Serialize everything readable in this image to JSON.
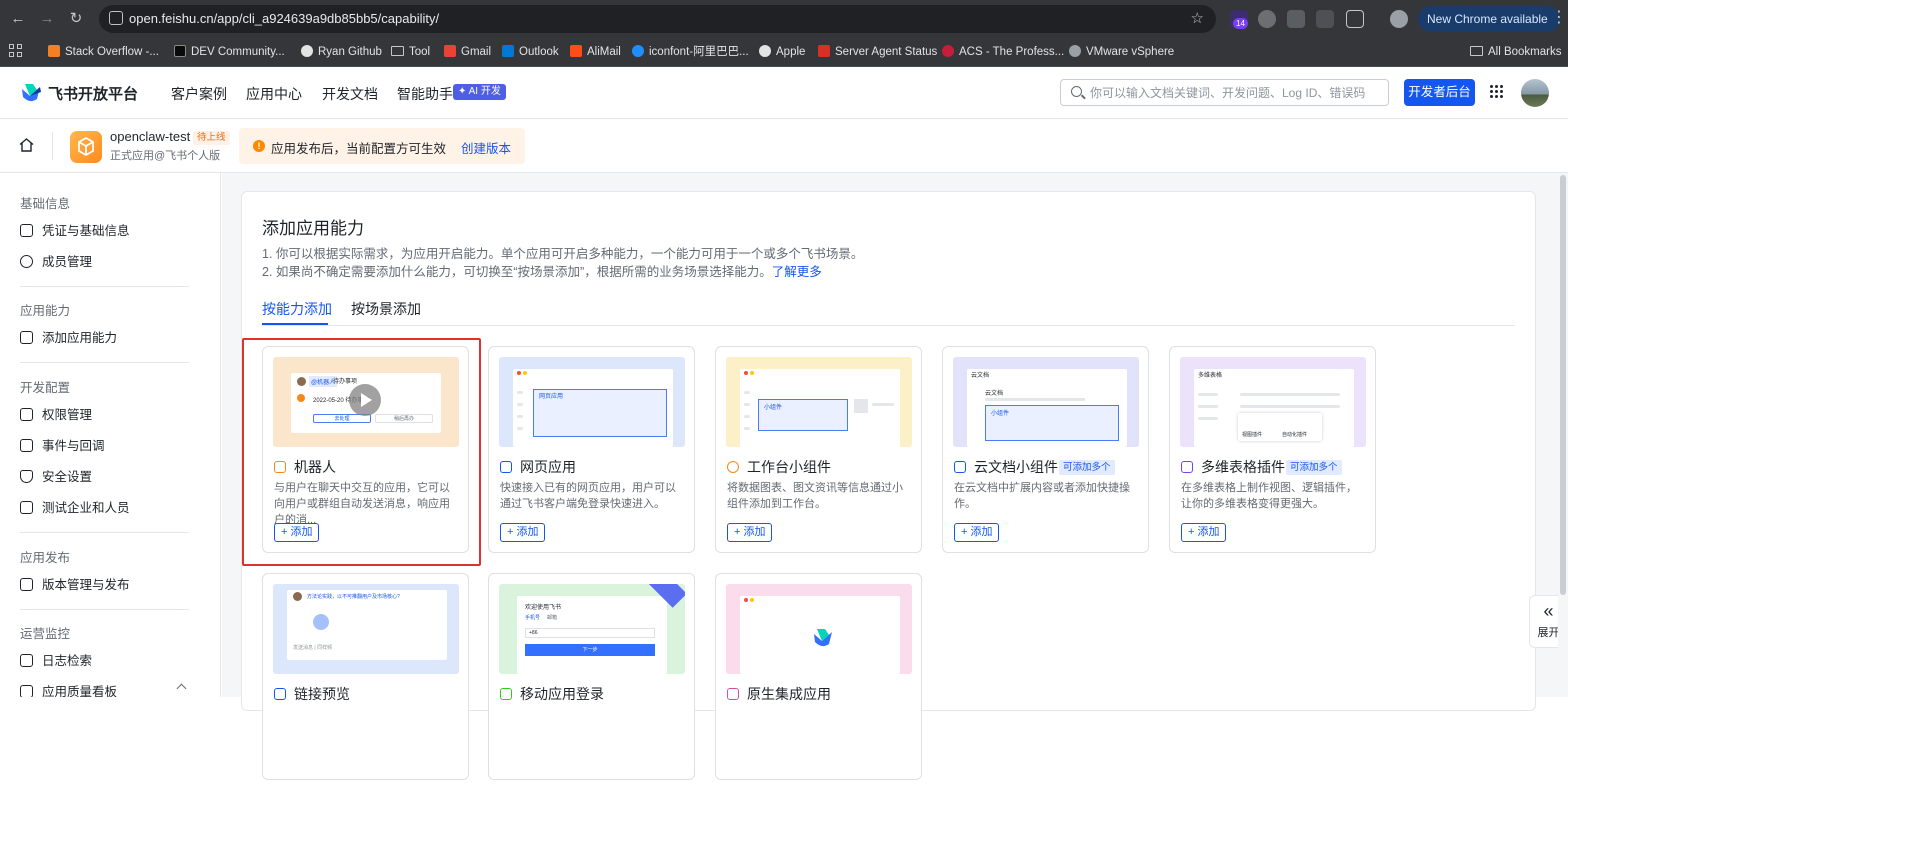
{
  "browser": {
    "url": "open.feishu.cn/app/cli_a924639a9db85bb5/capability/",
    "ext_badge": "14",
    "new_chrome": "New Chrome available",
    "bookmarks": [
      "Stack Overflow -...",
      "DEV Community...",
      "Ryan Github",
      "Tool",
      "Gmail",
      "Outlook",
      "AliMail",
      "iconfont-阿里巴巴...",
      "Apple",
      "Server Agent Status",
      "ACS - The Profess...",
      "VMware vSphere"
    ],
    "all_bookmarks": "All Bookmarks"
  },
  "header": {
    "logo": "飞书开放平台",
    "nav": [
      "客户案例",
      "应用中心",
      "开发文档",
      "智能助手"
    ],
    "ai_badge": "✦ AI 开发",
    "search_placeholder": "你可以输入文档关键词、开发问题、Log ID、错误码",
    "dev_button": "开发者后台"
  },
  "app": {
    "name": "openclaw-test",
    "status": "待上线",
    "subtitle": "正式应用@飞书个人版",
    "notice": "应用发布后，当前配置方可生效",
    "create_version": "创建版本"
  },
  "sidebar": {
    "groups": [
      {
        "title": "基础信息",
        "items": [
          "凭证与基础信息",
          "成员管理"
        ]
      },
      {
        "title": "应用能力",
        "items": [
          "添加应用能力"
        ]
      },
      {
        "title": "开发配置",
        "items": [
          "权限管理",
          "事件与回调",
          "安全设置",
          "测试企业和人员"
        ]
      },
      {
        "title": "应用发布",
        "items": [
          "版本管理与发布"
        ]
      },
      {
        "title": "运营监控",
        "items": [
          "日志检索",
          "应用质量看板"
        ]
      }
    ]
  },
  "main": {
    "title": "添加应用能力",
    "desc1": "1. 你可以根据实际需求，为应用开启能力。单个应用可开启多种能力，一个能力可用于一个或多个飞书场景。",
    "desc2": "2. 如果尚不确定需要添加什么能力，可切换至“按场景添加”，根据所需的业务场景选择能力。",
    "learn_more": "了解更多",
    "tabs": [
      "按能力添加",
      "按场景添加"
    ],
    "add_label": "+ 添加",
    "multi_tag": "可添加多个",
    "cards": [
      {
        "title": "机器人",
        "desc": "与用户在聊天中交互的应用，它可以向用户或群组自动发送消息，响应用户的消...",
        "preview": {
          "chip": "@机器人",
          "chip2": "待办事项",
          "date": "2022-05-20 待办事项",
          "btn1": "去处理",
          "btn2": "稍后再办"
        }
      },
      {
        "title": "网页应用",
        "desc": "快速接入已有的网页应用，用户可以通过飞书客户端免登录快速进入。",
        "preview": {
          "label": "网页应用"
        }
      },
      {
        "title": "工作台小组件",
        "desc": "将数据图表、图文资讯等信息通过小组件添加到工作台。",
        "preview": {
          "label": "小组件"
        }
      },
      {
        "title": "云文档小组件",
        "desc": "在云文档中扩展内容或者添加快捷操作。",
        "preview": {
          "header": "云文档",
          "line": "云文档",
          "label": "小组件"
        }
      },
      {
        "title": "多维表格插件",
        "desc": "在多维表格上制作视图、逻辑插件，让你的多维表格变得更强大。",
        "preview": {
          "header": "多维表格",
          "btn1": "视图插件",
          "btn2": "自动化插件"
        }
      },
      {
        "title": "链接预览",
        "desc": "",
        "preview": {
          "text": "方法论实践，以不可推翻用户及市场核心?",
          "input": "发送消息 | 同样频"
        }
      },
      {
        "title": "移动应用登录",
        "desc": "",
        "preview": {
          "welcome": "欢迎使用飞书",
          "tab1": "手机号",
          "tab2": "邮箱",
          "code": "+86",
          "next": "下一步"
        }
      },
      {
        "title": "原生集成应用",
        "desc": "",
        "preview": {}
      }
    ]
  },
  "expand_label": "展开"
}
